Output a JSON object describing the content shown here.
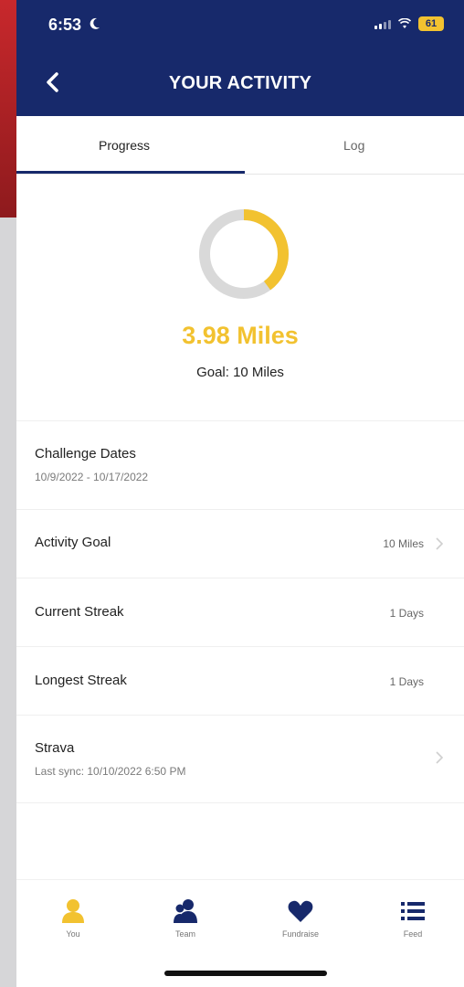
{
  "status_bar": {
    "time": "6:53",
    "battery": "61"
  },
  "header": {
    "title": "YOUR ACTIVITY"
  },
  "tabs": [
    {
      "label": "Progress",
      "active": true
    },
    {
      "label": "Log",
      "active": false
    }
  ],
  "progress": {
    "value_text": "3.98 Miles",
    "goal_text": "Goal: 10 Miles",
    "fraction": 0.398,
    "ring_color": "#f2c230",
    "ring_track_color": "#d9d9d9"
  },
  "rows": {
    "challenge_dates": {
      "title": "Challenge Dates",
      "subtitle": "10/9/2022 - 10/17/2022"
    },
    "activity_goal": {
      "title": "Activity Goal",
      "value": "10 Miles"
    },
    "current_streak": {
      "title": "Current Streak",
      "value": "1 Days"
    },
    "longest_streak": {
      "title": "Longest Streak",
      "value": "1 Days"
    },
    "strava": {
      "title": "Strava",
      "subtitle": "Last sync: 10/10/2022 6:50 PM"
    }
  },
  "tabbar": [
    {
      "label": "You",
      "icon": "person-icon",
      "active": true
    },
    {
      "label": "Team",
      "icon": "team-icon",
      "active": false
    },
    {
      "label": "Fundraise",
      "icon": "heart-icon",
      "active": false
    },
    {
      "label": "Feed",
      "icon": "list-icon",
      "active": false
    }
  ],
  "colors": {
    "navy": "#17296b",
    "accent": "#f2c230"
  }
}
